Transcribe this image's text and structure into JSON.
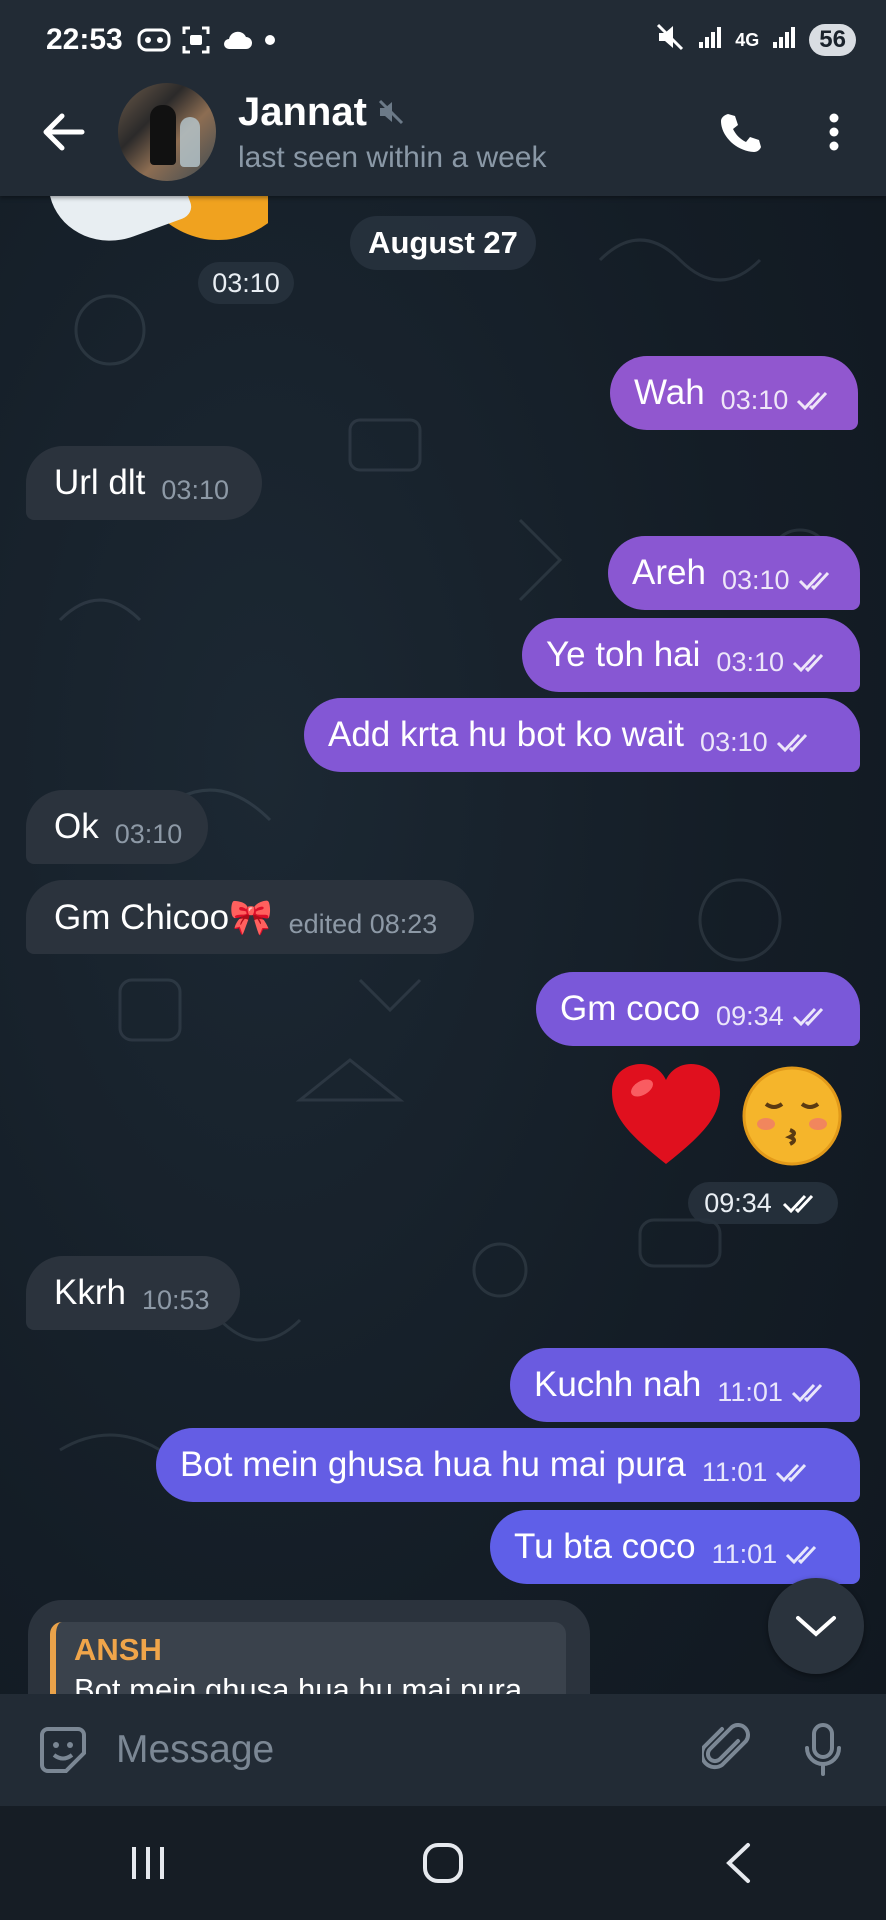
{
  "status_bar": {
    "time": "22:53",
    "battery": "56",
    "network": "4G"
  },
  "header": {
    "contact_name": "Jannat",
    "contact_status": "last seen within a week"
  },
  "date_separator": "August 27",
  "sticker_time": "03:10",
  "messages": [
    {
      "dir": "out",
      "text": "Wah",
      "time": "03:10"
    },
    {
      "dir": "in",
      "text": "Url dlt",
      "time": "03:10"
    },
    {
      "dir": "out",
      "text": "Areh",
      "time": "03:10"
    },
    {
      "dir": "out",
      "text": "Ye toh hai",
      "time": "03:10"
    },
    {
      "dir": "out",
      "text": "Add krta hu bot ko wait",
      "time": "03:10"
    },
    {
      "dir": "in",
      "text": "Ok",
      "time": "03:10"
    },
    {
      "dir": "in",
      "text": "Gm Chicoo🎀",
      "time": "edited 08:23"
    },
    {
      "dir": "out",
      "text": "Gm coco",
      "time": "09:34"
    },
    {
      "dir": "in",
      "text": "Kkrh",
      "time": "10:53"
    },
    {
      "dir": "out",
      "text": "Kuchh nah",
      "time": "11:01"
    },
    {
      "dir": "out",
      "text": "Bot mein ghusa hua hu mai pura",
      "time": "11:01"
    },
    {
      "dir": "out",
      "text": "Tu bta coco",
      "time": "11:01"
    }
  ],
  "emoji_message": {
    "emojis": [
      "❤",
      "😚"
    ],
    "time": "09:34"
  },
  "reply_preview": {
    "author": "ANSH",
    "text": "Bot mein ghusa hua hu mai pura"
  },
  "composer": {
    "placeholder": "Message"
  },
  "colors": {
    "outgoing_top": "#9b59d0",
    "outgoing_bottom": "#5f6ef0",
    "incoming": "#2b333d",
    "reply_accent": "#e9a24a"
  }
}
